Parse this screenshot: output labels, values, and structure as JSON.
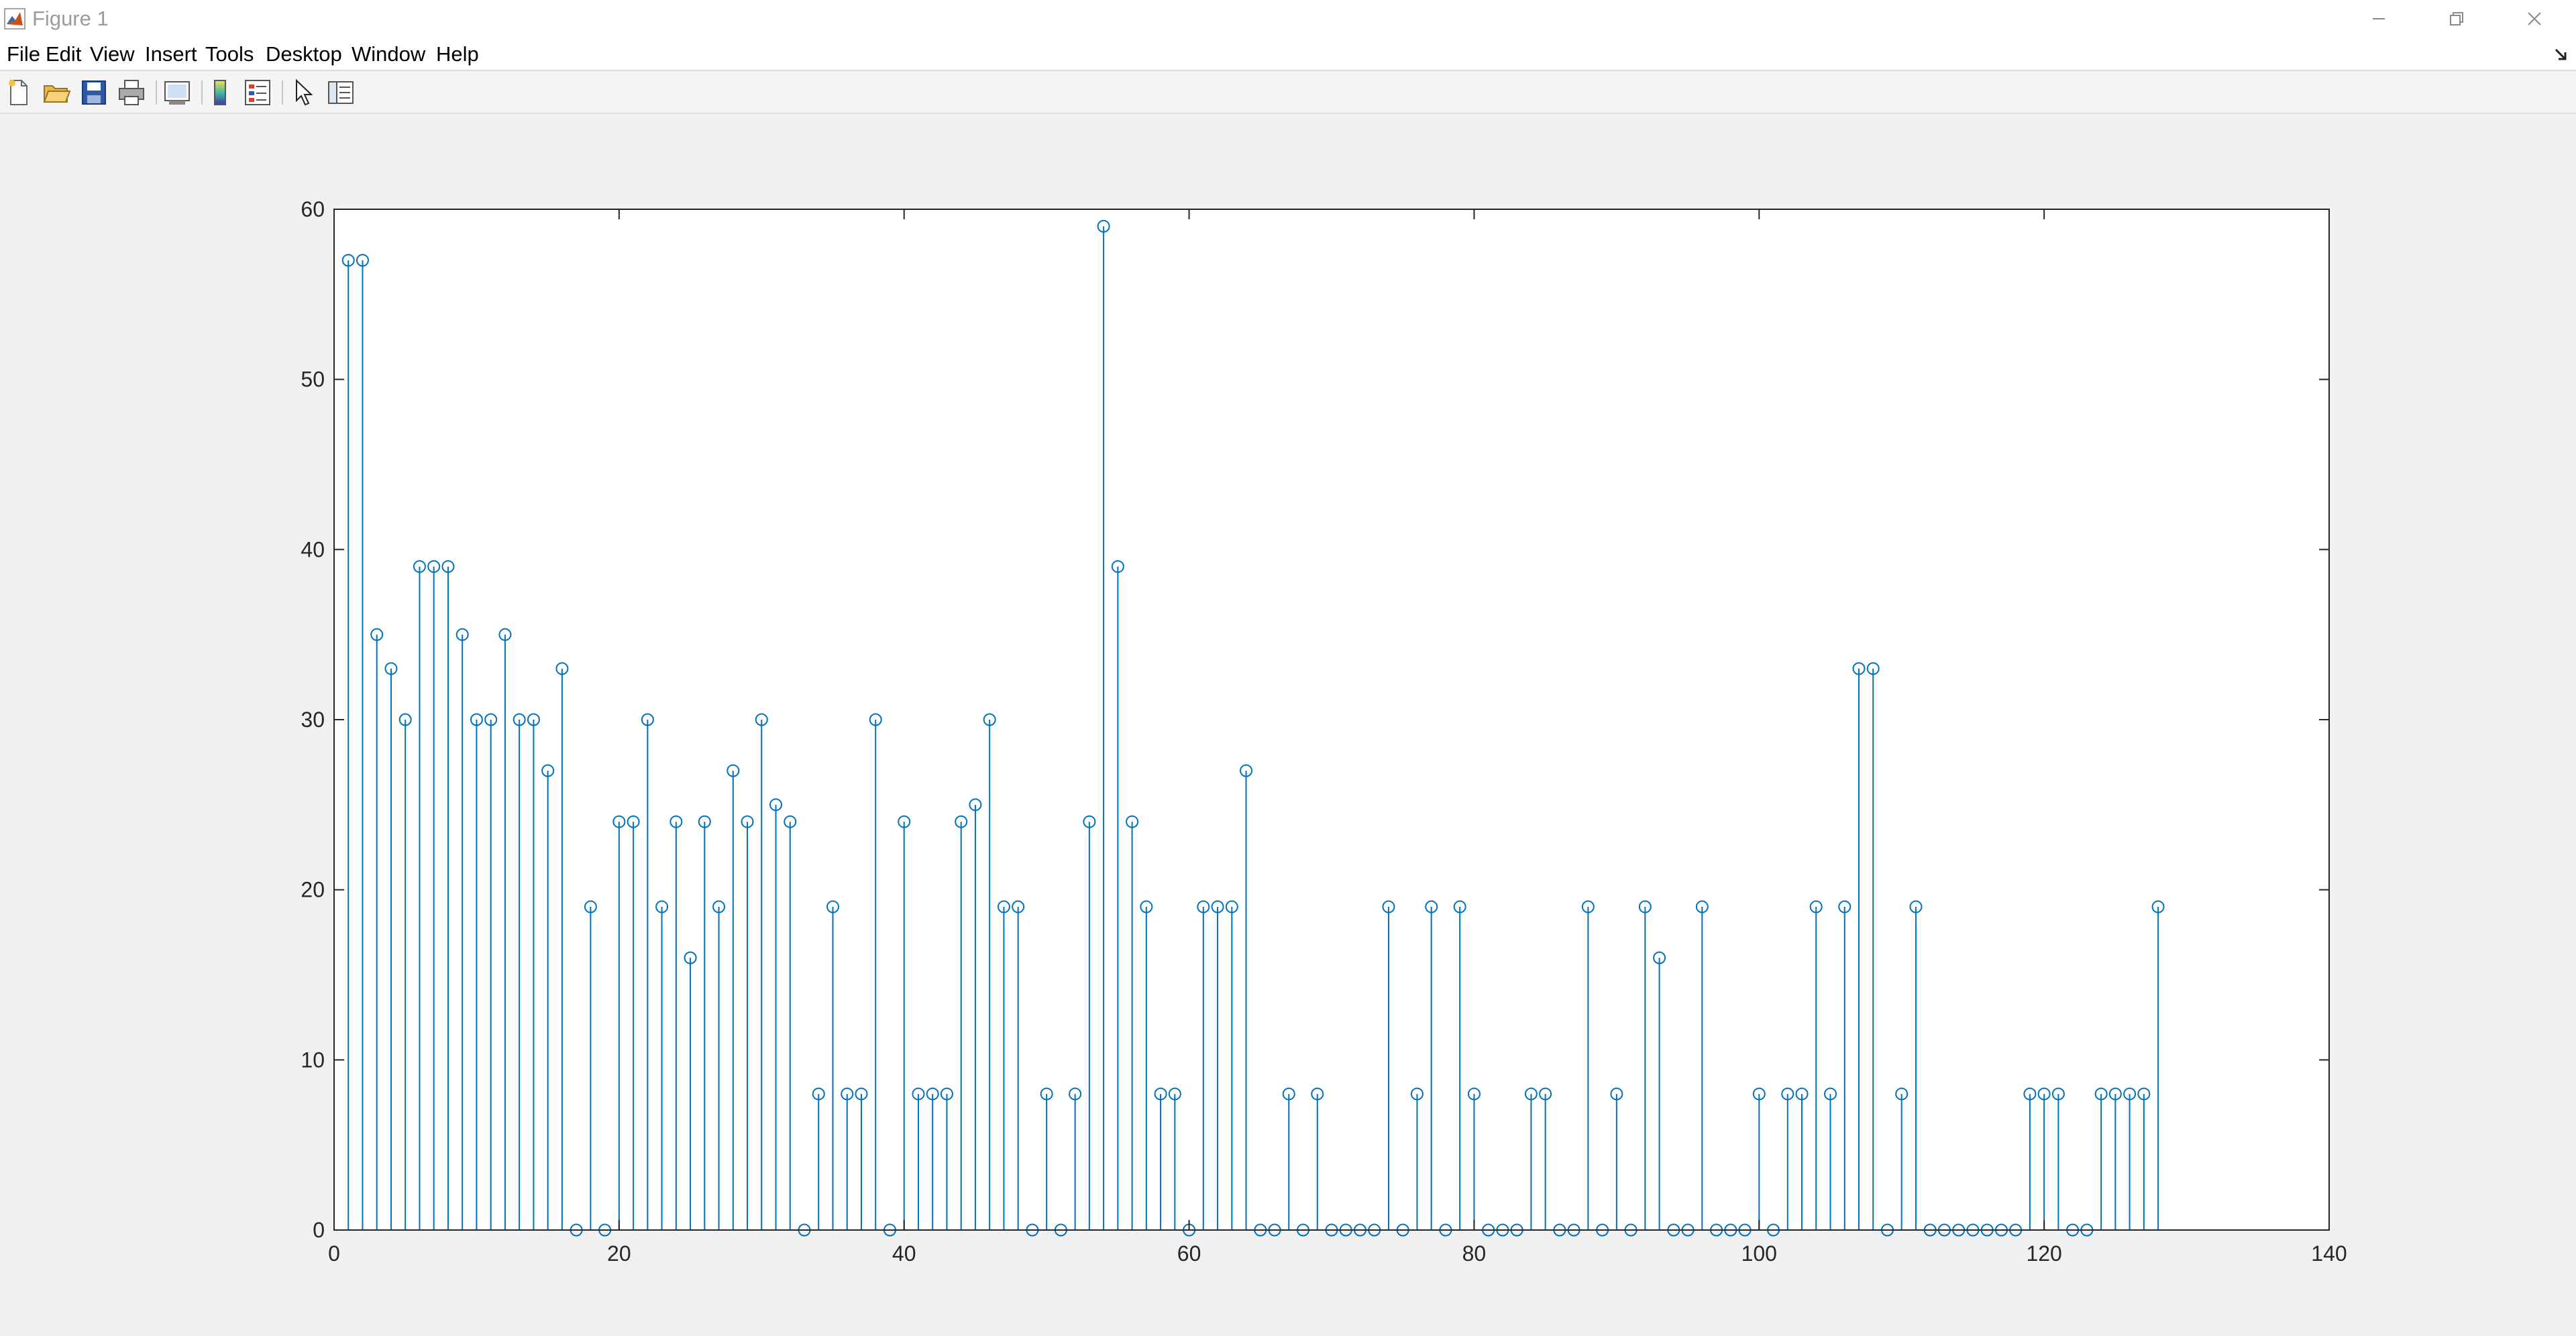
{
  "window": {
    "title": "Figure 1",
    "icon": "matlab-logo-icon",
    "controls": [
      "minimize-icon",
      "restore-icon",
      "close-icon"
    ]
  },
  "menu": {
    "items": [
      "File",
      "Edit",
      "View",
      "Insert",
      "Tools",
      "Desktop",
      "Window",
      "Help"
    ],
    "dock_icon": "dock-arrow-icon"
  },
  "toolbar": {
    "buttons": [
      {
        "name": "new-figure-button",
        "icon": "new-file-icon"
      },
      {
        "name": "open-file-button",
        "icon": "folder-open-icon"
      },
      {
        "name": "save-figure-button",
        "icon": "save-icon"
      },
      {
        "name": "print-figure-button",
        "icon": "printer-icon"
      },
      {
        "name": "link-plot-button",
        "icon": "link-plot-icon"
      },
      {
        "name": "insert-colorbar-button",
        "icon": "colorbar-icon"
      },
      {
        "name": "insert-legend-button",
        "icon": "legend-icon"
      },
      {
        "name": "edit-plot-button",
        "icon": "arrow-pointer-icon"
      },
      {
        "name": "property-inspector-button",
        "icon": "plot-tools-icon"
      }
    ]
  },
  "colors": {
    "stem": "#0072bd",
    "axes": "#262626",
    "figure_bg": "#f0f0f0",
    "axes_bg": "#ffffff"
  },
  "chart_data": {
    "type": "stem",
    "title": "",
    "xlabel": "",
    "ylabel": "",
    "xlim": [
      0,
      140
    ],
    "ylim": [
      0,
      60
    ],
    "xticks": [
      0,
      20,
      40,
      60,
      80,
      100,
      120,
      140
    ],
    "yticks": [
      0,
      10,
      20,
      30,
      40,
      50,
      60
    ],
    "xtick_labels": [
      "0",
      "20",
      "40",
      "60",
      "80",
      "100",
      "120",
      "140"
    ],
    "ytick_labels": [
      "0",
      "10",
      "20",
      "30",
      "40",
      "50",
      "60"
    ],
    "grid": false,
    "marker": "circle-open",
    "series": [
      {
        "x": [
          1,
          2,
          3,
          4,
          5,
          6,
          7,
          8,
          9,
          10,
          11,
          12,
          13,
          14,
          15,
          16,
          17,
          18,
          19,
          20,
          21,
          22,
          23,
          24,
          25,
          26,
          27,
          28,
          29,
          30,
          31,
          32,
          33,
          34,
          35,
          36,
          37,
          38,
          39,
          40,
          41,
          42,
          43,
          44,
          45,
          46,
          47,
          48,
          49,
          50,
          51,
          52,
          53,
          54,
          55,
          56,
          57,
          58,
          59,
          60,
          61,
          62,
          63,
          64,
          65,
          66,
          67,
          68,
          69,
          70,
          71,
          72,
          73,
          74,
          75,
          76,
          77,
          78,
          79,
          80,
          81,
          82,
          83,
          84,
          85,
          86,
          87,
          88,
          89,
          90,
          91,
          92,
          93,
          94,
          95,
          96,
          97,
          98,
          99,
          100,
          101,
          102,
          103,
          104,
          105,
          106,
          107,
          108,
          109,
          110,
          111,
          112,
          113,
          114,
          115,
          116,
          117,
          118,
          119,
          120,
          121,
          122,
          123,
          124,
          125,
          126,
          127,
          128
        ],
        "values": [
          57,
          57,
          35,
          33,
          30,
          39,
          39,
          39,
          35,
          30,
          30,
          35,
          30,
          30,
          27,
          33,
          0,
          19,
          0,
          24,
          24,
          30,
          19,
          24,
          16,
          24,
          19,
          27,
          24,
          30,
          25,
          24,
          0,
          8,
          19,
          8,
          8,
          30,
          0,
          24,
          8,
          8,
          8,
          24,
          25,
          30,
          19,
          19,
          0,
          8,
          0,
          8,
          24,
          59,
          39,
          24,
          19,
          8,
          8,
          0,
          19,
          19,
          19,
          27,
          0,
          0,
          8,
          0,
          8,
          0,
          0,
          0,
          0,
          19,
          0,
          8,
          19,
          0,
          19,
          8,
          0,
          0,
          0,
          8,
          8,
          0,
          0,
          19,
          0,
          8,
          0,
          19,
          16,
          0,
          0,
          19,
          0,
          0,
          0,
          8,
          0,
          8,
          8,
          19,
          8,
          19,
          33,
          33,
          0,
          8,
          19,
          0,
          0,
          0,
          0,
          0,
          0,
          0,
          8,
          8,
          8,
          0,
          0,
          8,
          8,
          8,
          8,
          19
        ]
      }
    ]
  }
}
